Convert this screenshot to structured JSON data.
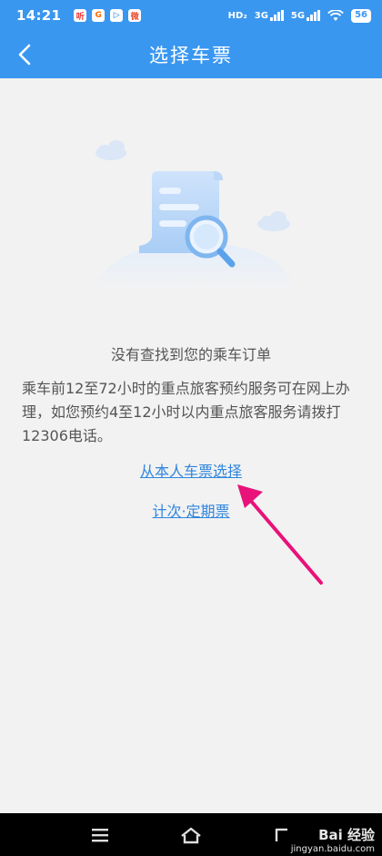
{
  "status_bar": {
    "time": "14:21",
    "app_badges": [
      "听",
      "G",
      "▷",
      "微"
    ],
    "hd_label": "HD₂",
    "net_3g": "3G",
    "net_5g": "5G",
    "battery": "56"
  },
  "nav": {
    "title": "选择车票",
    "back_icon": "chevron-left-icon"
  },
  "empty_state": {
    "title": "没有查找到您的乘车订单",
    "description": "乘车前12至72小时的重点旅客预约服务可在网上办理，如您预约4至12小时以内重点旅客服务请拨打12306电话。"
  },
  "links": {
    "select_own_ticket": "从本人车票选择",
    "count_ticket": "计次·定期票"
  },
  "annotation": {
    "arrow_color": "#e8127a"
  },
  "colors": {
    "brand": "#3a97f0",
    "link": "#2f86de"
  },
  "watermark": {
    "brand": "Bai 经验",
    "domain": "jingyan.baidu.com"
  }
}
